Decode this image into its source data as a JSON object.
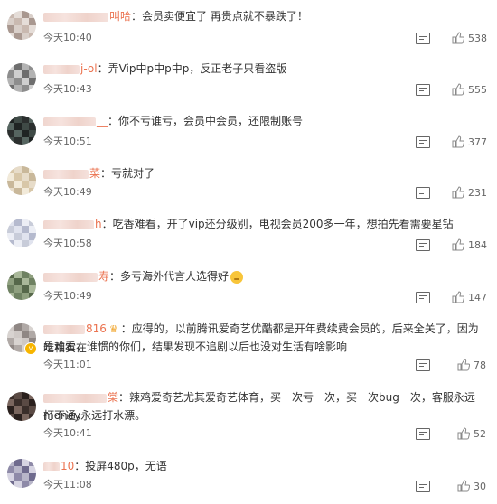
{
  "comments": [
    {
      "name_visible": "叫哈",
      "text": "：会员卖便宜了 再贵点就不暴跌了！",
      "time": "今天10:40",
      "likes": "538",
      "avatar_colors": [
        "#c9b9b0",
        "#d9cfc9",
        "#a99890",
        "#e5ddd8"
      ]
    },
    {
      "name_visible": "j-ol",
      "text": "：弄Vip中p中p中p，反正老子只看盗版",
      "time": "今天10:43",
      "likes": "555",
      "avatar_colors": [
        "#8d8d8d",
        "#b3b3b3",
        "#6e6e6e",
        "#cfcfcf"
      ]
    },
    {
      "name_visible": "__",
      "text": "：你不亏谁亏，会员中会员，还限制账号",
      "time": "今天10:51",
      "likes": "377",
      "avatar_colors": [
        "#2b2f2e",
        "#3f4a46",
        "#1f2423",
        "#566560"
      ]
    },
    {
      "name_visible": "菜",
      "text": "：亏就对了",
      "time": "今天10:49",
      "likes": "231",
      "avatar_colors": [
        "#e7dcc9",
        "#d8c7a8",
        "#f2ead9",
        "#c9b89a"
      ]
    },
    {
      "name_visible": "h",
      "text": "：吃香难看，开了vip还分级别，电视会员200多一年，想拍先看需要星钻",
      "time": "今天10:58",
      "likes": "184",
      "avatar_colors": [
        "#e0e3ee",
        "#c8ccd9",
        "#eceef5",
        "#b5bace"
      ]
    },
    {
      "name_visible": "寿",
      "text": "：多亏海外代言人选得好",
      "time": "今天10:49",
      "likes": "147",
      "avatar_colors": [
        "#8fa07f",
        "#6f8262",
        "#a9b899",
        "#56684a"
      ]
    },
    {
      "name_visible": "816",
      "text_line1": "：应得的，以前腾讯爱奇艺优酷都是开年费续费会员的，后来全关了，因为吃相实在",
      "text_line2": "是难看，谁惯的你们，结果发现不追剧以后也没对生活有啥影响",
      "time": "今天11:01",
      "likes": "78",
      "avatar_colors": [
        "#b0a9a6",
        "#8f8784",
        "#cfc9c6",
        "#d8d3d0"
      ]
    },
    {
      "name_visible": "棠",
      "text_line1": "：辣鸡爱奇艺尤其爱奇艺体育，买一次亏一次，买一次bug一次，客服永远打不通，",
      "text_line2": "money永远打水漂。",
      "time": "今天10:41",
      "likes": "52",
      "avatar_colors": [
        "#5a4a44",
        "#3a2e2a",
        "#7a665e",
        "#2a201d"
      ]
    },
    {
      "name_visible": "10",
      "text": "：投屏480p，无语",
      "time": "今天11:08",
      "likes": "30",
      "avatar_colors": [
        "#b8b6c9",
        "#8e8aa8",
        "#d6d4e2",
        "#6f6b8e"
      ]
    }
  ]
}
